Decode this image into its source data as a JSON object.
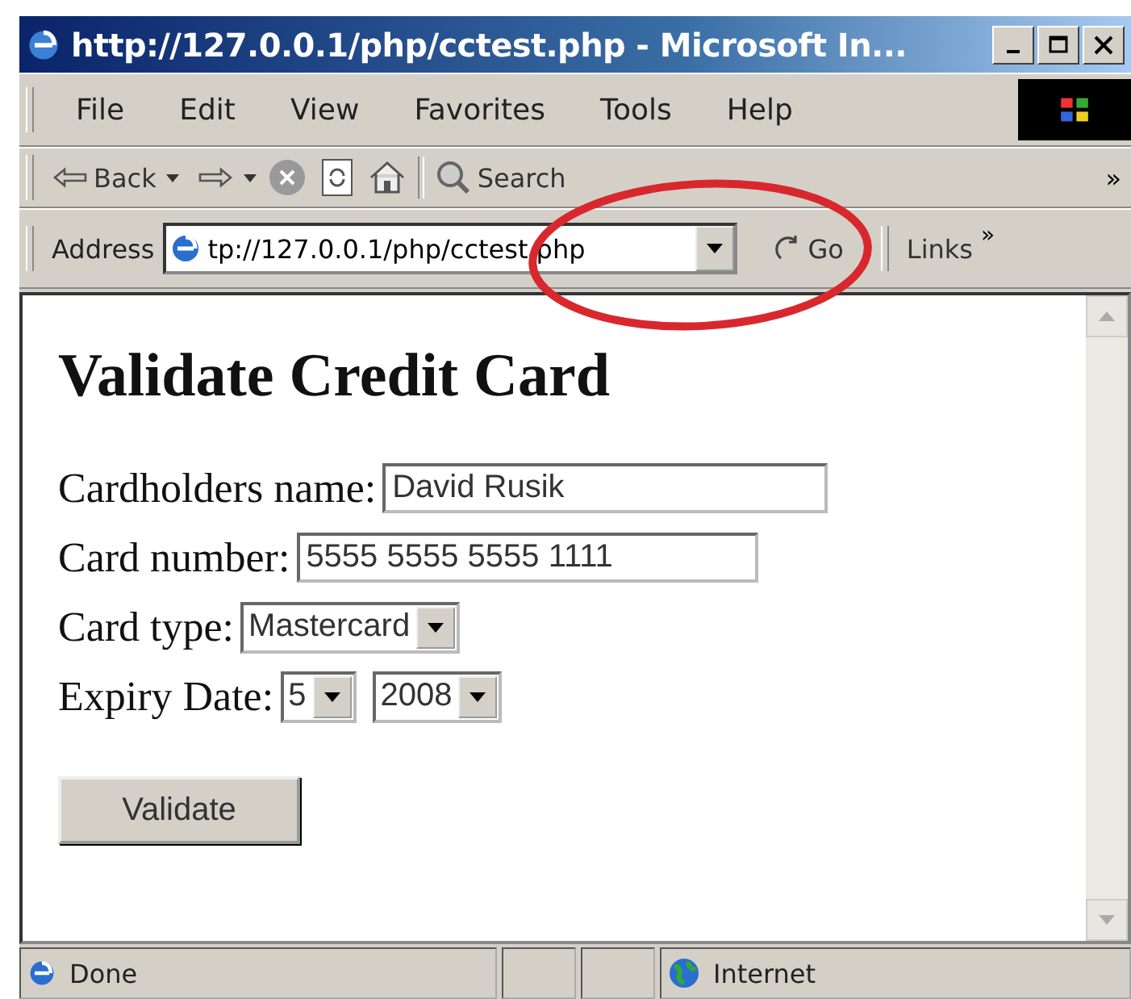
{
  "window": {
    "title": "http://127.0.0.1/php/cctest.php - Microsoft In..."
  },
  "menu": [
    "File",
    "Edit",
    "View",
    "Favorites",
    "Tools",
    "Help"
  ],
  "toolbar": {
    "back": "Back",
    "search": "Search",
    "overflow": "»"
  },
  "address_bar": {
    "label": "Address",
    "value": "tp://127.0.0.1/php/cctest.php",
    "go": "Go",
    "links": "Links",
    "overflow": "»"
  },
  "page": {
    "heading": "Validate Credit Card",
    "fields": [
      {
        "kind": "text",
        "label": "Cardholders name:",
        "value": "David Rusik"
      },
      {
        "kind": "text",
        "label": "Card number:",
        "value": "5555 5555 5555 1111"
      },
      {
        "kind": "select",
        "label": "Card type:",
        "values": [
          "Mastercard"
        ]
      },
      {
        "kind": "select",
        "label": "Expiry Date:",
        "values": [
          "5",
          "2008"
        ]
      }
    ],
    "button": "Validate"
  },
  "status_bar": {
    "status": "Done",
    "zone": "Internet"
  }
}
